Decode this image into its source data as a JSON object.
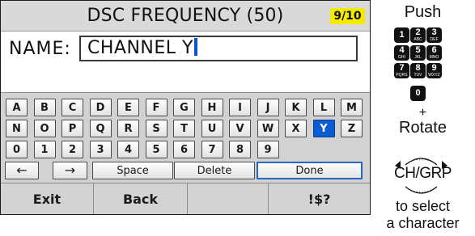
{
  "screen": {
    "title": "DSC FREQUENCY (50)",
    "page_indicator": "9/10",
    "name_label": "NAME:",
    "name_value": "CHANNEL Y"
  },
  "keyboard": {
    "rows": [
      [
        "A",
        "B",
        "C",
        "D",
        "E",
        "F",
        "G",
        "H",
        "I",
        "J",
        "K",
        "L",
        "M"
      ],
      [
        "N",
        "O",
        "P",
        "Q",
        "R",
        "S",
        "T",
        "U",
        "V",
        "W",
        "X",
        "Y",
        "Z"
      ],
      [
        "0",
        "1",
        "2",
        "3",
        "4",
        "5",
        "6",
        "7",
        "8",
        "9"
      ]
    ],
    "selected_key": "Y",
    "left_arrow": "←",
    "right_arrow": "→",
    "space_label": "Space",
    "delete_label": "Delete",
    "done_label": "Done"
  },
  "softkeys": {
    "exit": "Exit",
    "back": "Back",
    "empty": "",
    "symbols": "!$?"
  },
  "instructions": {
    "push": "Push",
    "plus": "+",
    "rotate": "Rotate",
    "knob_label": "CH/GRP",
    "to_select": "to select",
    "a_character": "a character",
    "keypad": [
      {
        "digit": "1",
        "letters": ""
      },
      {
        "digit": "2",
        "letters": "ABC"
      },
      {
        "digit": "3",
        "letters": "DEF"
      },
      {
        "digit": "4",
        "letters": "GHI"
      },
      {
        "digit": "5",
        "letters": "JKL"
      },
      {
        "digit": "6",
        "letters": "MNO"
      },
      {
        "digit": "7",
        "letters": "PQRS"
      },
      {
        "digit": "8",
        "letters": "TUV"
      },
      {
        "digit": "9",
        "letters": "WXYZ"
      },
      {
        "digit": "0",
        "letters": ""
      }
    ]
  },
  "colors": {
    "selected_key": "#0b5bd3",
    "page_badge": "#f4ea00",
    "cursor": "#0a53c9"
  }
}
